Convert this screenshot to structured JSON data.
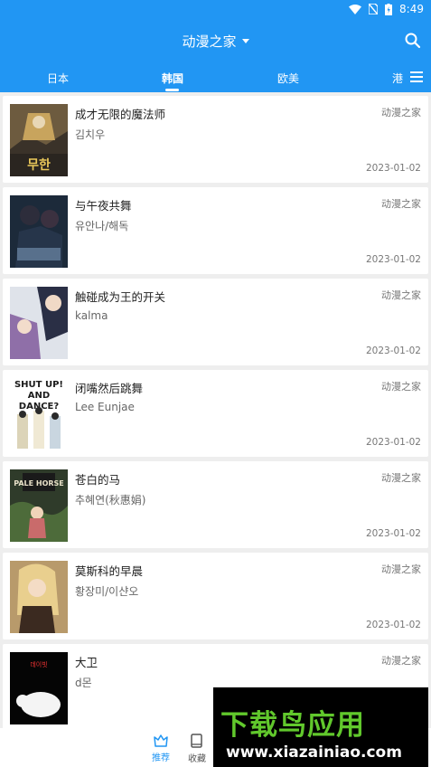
{
  "status_bar": {
    "time": "8:49"
  },
  "app_bar": {
    "title": "动漫之家"
  },
  "tabs": [
    {
      "label": "日本"
    },
    {
      "label": "韩国",
      "active": true
    },
    {
      "label": "欧美"
    },
    {
      "label": "港"
    }
  ],
  "comics": [
    {
      "title": "成才无限的魔法师",
      "author": "김치우",
      "source": "动漫之家",
      "date": "2023-01-02",
      "cover_text": "무한"
    },
    {
      "title": "与午夜共舞",
      "author": "유안나/해독",
      "source": "动漫之家",
      "date": "2023-01-02",
      "cover_text": ""
    },
    {
      "title": "触碰成为王的开关",
      "author": "kalma",
      "source": "动漫之家",
      "date": "2023-01-02",
      "cover_text": ""
    },
    {
      "title": "闭嘴然后跳舞",
      "author": "Lee Eunjae",
      "source": "动漫之家",
      "date": "2023-01-02",
      "cover_text": "SHUT UP! AND DANCE?"
    },
    {
      "title": "苍白的马",
      "author": "추혜연(秋惠娟)",
      "source": "动漫之家",
      "date": "2023-01-02",
      "cover_text": "PALE HORSE"
    },
    {
      "title": "莫斯科的早晨",
      "author": "황장미/이샨오",
      "source": "动漫之家",
      "date": "2023-01-02",
      "cover_text": ""
    },
    {
      "title": "大卫",
      "author": "d몬",
      "source": "动漫之家",
      "date": "",
      "cover_text": "데이빗"
    }
  ],
  "bottom_nav": [
    {
      "label": "推荐",
      "active": true
    },
    {
      "label": "收藏"
    }
  ],
  "watermark": {
    "title": "下载鸟应用",
    "url": "www.xiazainiao.com"
  },
  "colors": {
    "primary": "#2196f3",
    "background": "#eeeeee",
    "watermark_green": "#61c82c"
  }
}
